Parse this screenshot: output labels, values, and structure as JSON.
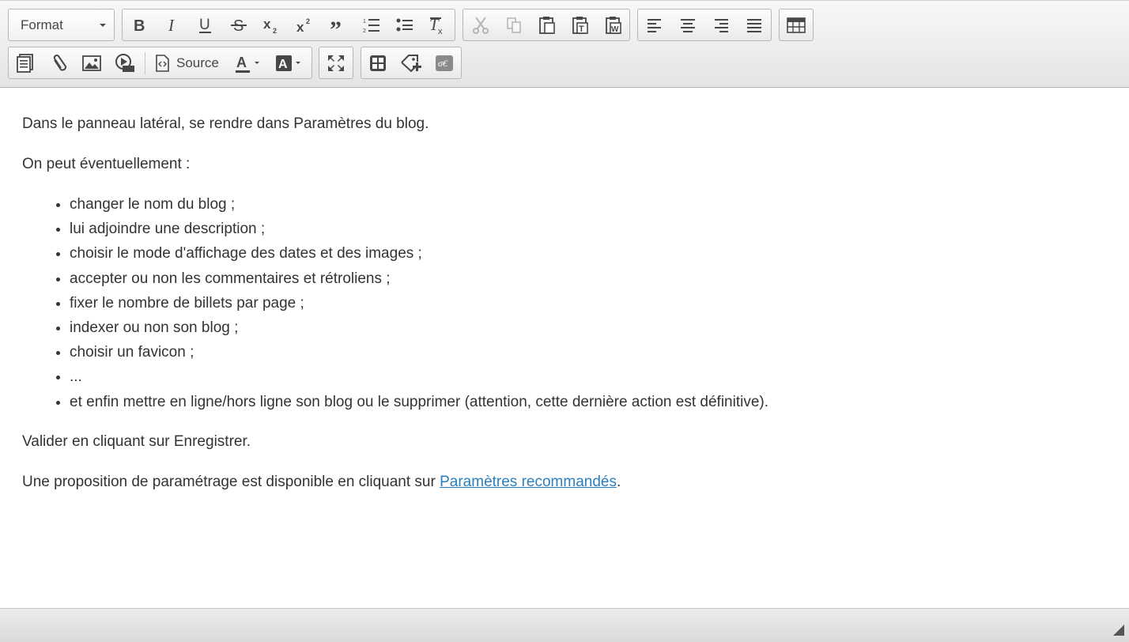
{
  "toolbar": {
    "format_label": "Format",
    "source_label": "Source",
    "row1_buttons": [
      "bold-icon",
      "italic-icon",
      "underline-icon",
      "strikethrough-icon",
      "subscript-icon",
      "superscript-icon",
      "blockquote-icon",
      "numbered-list-icon",
      "bulleted-list-icon",
      "remove-format-icon",
      "cut-icon",
      "copy-icon",
      "paste-icon",
      "paste-text-icon",
      "paste-word-icon",
      "align-left-icon",
      "align-center-icon",
      "align-right-icon",
      "justify-icon",
      "table-icon"
    ],
    "row2_buttons": [
      "templates-icon",
      "link-icon",
      "image-icon",
      "embed-media-icon",
      "source-icon",
      "text-color-icon",
      "background-color-icon",
      "maximize-icon",
      "show-blocks-icon",
      "anchor-icon",
      "special-character-icon"
    ]
  },
  "content": {
    "p1": "Dans le panneau latéral, se rendre dans Paramètres du blog.",
    "p2": "On peut éventuellement :",
    "list": [
      "changer le nom du blog ;",
      "lui adjoindre une description ;",
      "choisir le mode d'affichage des dates et des images ;",
      "accepter ou non les commentaires et rétroliens ;",
      "fixer le nombre de billets par page ;",
      "indexer ou non son blog ;",
      "choisir un favicon ;",
      "...",
      "et enfin mettre en ligne/hors ligne son blog ou le supprimer (attention, cette dernière action est définitive)."
    ],
    "p3": "Valider en cliquant sur Enregistrer.",
    "p4_before": "Une proposition de paramétrage est disponible en cliquant sur ",
    "p4_link": "Paramètres recommandés",
    "p4_after": "."
  },
  "colors": {
    "link": "#2a7fc0",
    "text": "#333333",
    "icon": "#474747"
  }
}
